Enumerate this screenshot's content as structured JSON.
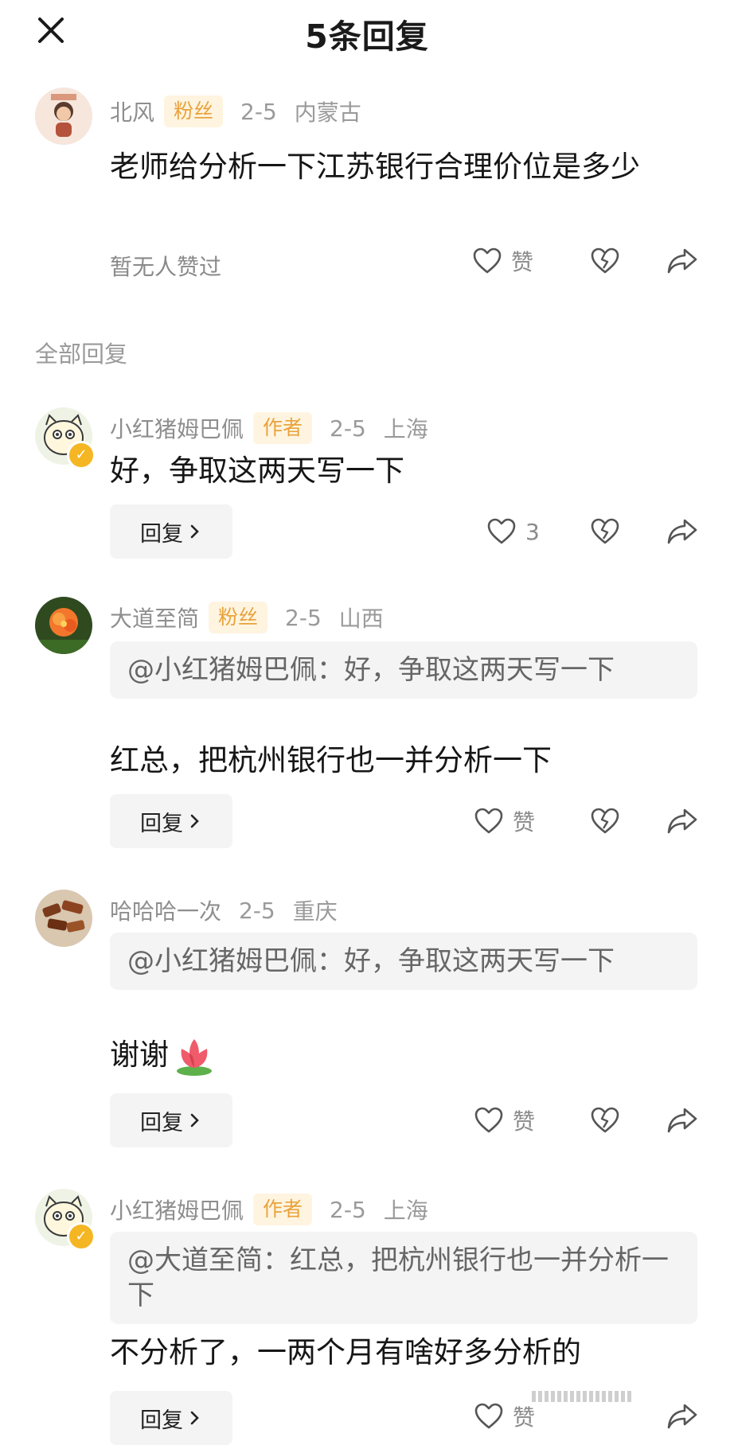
{
  "header": {
    "title": "5条回复",
    "close_icon": "close-icon"
  },
  "main_comment": {
    "name": "北风",
    "badge": "粉丝",
    "date": "2-5",
    "location": "内蒙古",
    "text": "老师给分析一下江苏银行合理价位是多少",
    "no_like_text": "暂无人赞过",
    "like_label": "赞"
  },
  "section_title": "全部回复",
  "replies": [
    {
      "name": "小红猪姆巴佩",
      "badge": "作者",
      "date": "2-5",
      "location": "上海",
      "text": "好，争取这两天写一下",
      "reply_label": "回复",
      "like_label": "3"
    },
    {
      "name": "大道至简",
      "badge": "粉丝",
      "date": "2-5",
      "location": "山西",
      "quote": "@小红猪姆巴佩：好，争取这两天写一下",
      "text": "红总，把杭州银行也一并分析一下",
      "reply_label": "回复",
      "like_label": "赞"
    },
    {
      "name": "哈哈哈一次",
      "date": "2-5",
      "location": "重庆",
      "quote": "@小红猪姆巴佩：好，争取这两天写一下",
      "text": "谢谢",
      "reply_label": "回复",
      "like_label": "赞"
    },
    {
      "name": "小红猪姆巴佩",
      "badge": "作者",
      "date": "2-5",
      "location": "上海",
      "quote": "@大道至简：红总，把杭州银行也一并分析一下",
      "text": "不分析了，一两个月有啥好多分析的",
      "reply_label": "回复",
      "like_label": "赞"
    }
  ],
  "colors": {
    "badge_bg": "#fff4e0",
    "badge_text": "#e8a33b",
    "meta_text": "#9a9a9a",
    "verify": "#f5b623"
  }
}
